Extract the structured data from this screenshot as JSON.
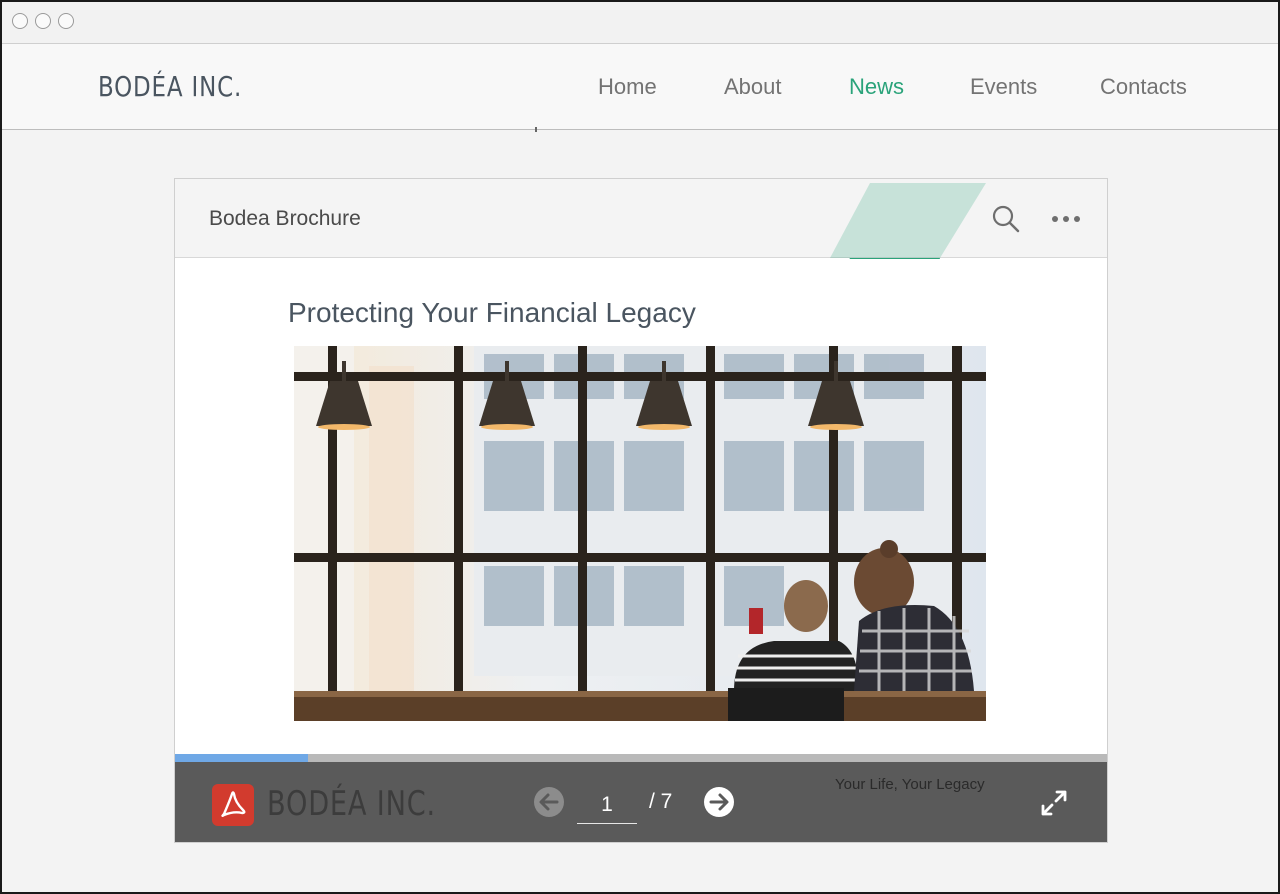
{
  "site": {
    "logo_text": "BODÉA INC.",
    "nav": [
      {
        "label": "Home"
      },
      {
        "label": "About"
      },
      {
        "label": "News",
        "active": true
      },
      {
        "label": "Events"
      },
      {
        "label": "Contacts"
      }
    ]
  },
  "viewer": {
    "document_title": "Bodea Brochure",
    "page_heading": "Protecting Your Financial Legacy",
    "current_page": "1",
    "total_pages": "/ 7",
    "progress_fraction": 0.143,
    "footer_caption": "Your Life, Your Legacy",
    "brand_logo_text": "BODÉA INC.",
    "icons": [
      "search-icon",
      "more-icon",
      "pdf-icon",
      "arrow-left-icon",
      "arrow-right-icon",
      "fullscreen-icon"
    ]
  },
  "colors": {
    "accent_green": "#2aa37a",
    "progress_blue": "#6fa8e6",
    "toolbar_gray": "#5a5a5a",
    "pdf_red": "#d23b2e"
  }
}
